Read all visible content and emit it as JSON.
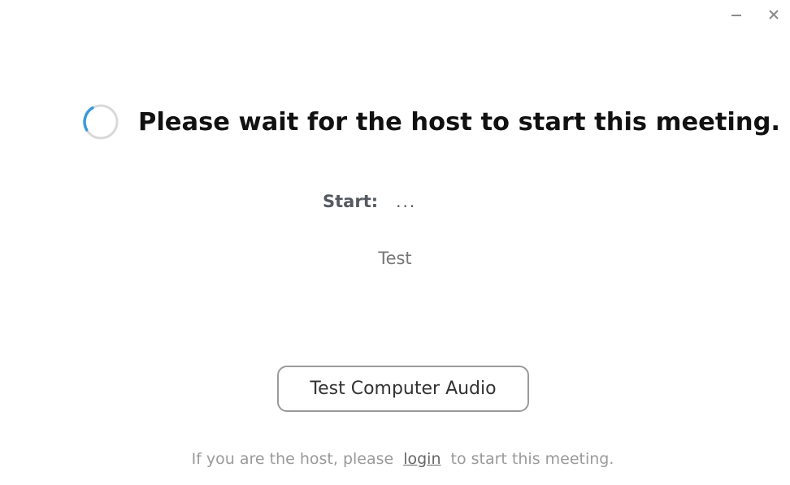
{
  "window": {
    "minimize_icon": "minimize-icon",
    "close_icon": "close-icon"
  },
  "waiting": {
    "spinner_icon": "loading-spinner-icon",
    "headline": "Please wait for the host to start this meeting."
  },
  "meeting": {
    "start_label": "Start:",
    "start_value": "...",
    "topic": "Test"
  },
  "actions": {
    "test_audio_label": "Test Computer Audio"
  },
  "footer": {
    "prefix": "If you are the host, please",
    "login_label": "login",
    "suffix": "to start this meeting."
  },
  "colors": {
    "spinner_accent": "#3a9ad9",
    "spinner_track": "#d9d9d9",
    "button_border": "#9a9a9a"
  }
}
